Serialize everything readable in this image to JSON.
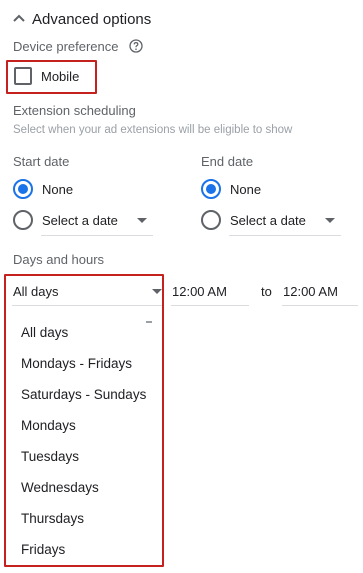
{
  "advanced": {
    "title": "Advanced options"
  },
  "device": {
    "label": "Device preference",
    "mobile_label": "Mobile",
    "mobile_checked": false
  },
  "scheduling": {
    "label": "Extension scheduling",
    "hint": "Select when your ad extensions will be eligible to show",
    "start": {
      "label": "Start date",
      "none_label": "None",
      "select_label": "Select a date",
      "selected": "None"
    },
    "end": {
      "label": "End date",
      "none_label": "None",
      "select_label": "Select a date",
      "selected": "None"
    }
  },
  "days_hours": {
    "label": "Days and hours",
    "days_value": "All days",
    "start_time": "12:00 AM",
    "to_label": "to",
    "end_time": "12:00 AM",
    "options": [
      "All days",
      "Mondays - Fridays",
      "Saturdays - Sundays",
      "Mondays",
      "Tuesdays",
      "Wednesdays",
      "Thursdays",
      "Fridays"
    ]
  },
  "colors": {
    "accent": "#1a73e8",
    "highlight": "#c5221f",
    "text": "#202124",
    "muted": "#5f6368"
  },
  "icons": {
    "toggle": "chevron-up-icon",
    "help": "help-icon",
    "dropdown": "dropdown-arrow-icon"
  }
}
